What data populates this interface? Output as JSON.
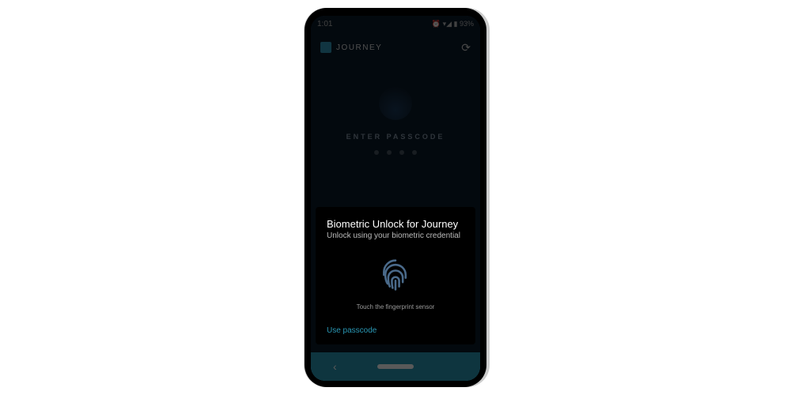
{
  "status_bar": {
    "time": "1:01",
    "icons": "⏰ ▾◢ ▮ 93%"
  },
  "app": {
    "name": "JOURNEY"
  },
  "passcode": {
    "prompt": "ENTER PASSCODE"
  },
  "biometric": {
    "title": "Biometric Unlock for Journey",
    "subtitle": "Unlock using your biometric credential",
    "hint": "Touch the fingerprint sensor",
    "alt_action": "Use passcode"
  },
  "colors": {
    "accent": "#2a98b5",
    "background": "#0a1a2a"
  }
}
